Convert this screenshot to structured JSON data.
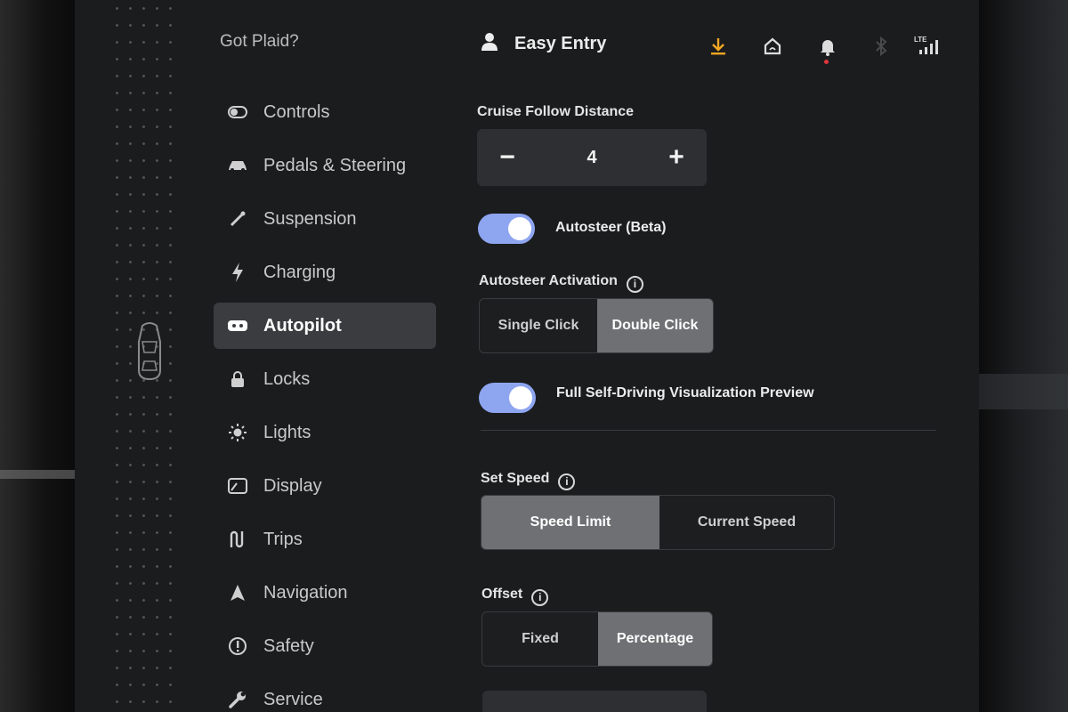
{
  "sidebar": {
    "profile_name": "Got Plaid?",
    "items": [
      {
        "label": "Controls"
      },
      {
        "label": "Pedals & Steering"
      },
      {
        "label": "Suspension"
      },
      {
        "label": "Charging"
      },
      {
        "label": "Autopilot",
        "active": true
      },
      {
        "label": "Locks"
      },
      {
        "label": "Lights"
      },
      {
        "label": "Display"
      },
      {
        "label": "Trips"
      },
      {
        "label": "Navigation"
      },
      {
        "label": "Safety"
      },
      {
        "label": "Service"
      }
    ]
  },
  "topbar": {
    "user_label": "Easy Entry",
    "network_label": "LTE",
    "accent_color": "#f5a623"
  },
  "autopilot": {
    "cruise_follow_label": "Cruise Follow Distance",
    "cruise_follow_value": "4",
    "autosteer_label": "Autosteer (Beta)",
    "autosteer_on": true,
    "activation_label": "Autosteer Activation",
    "activation_options": [
      "Single Click",
      "Double Click"
    ],
    "activation_selected": "Double Click",
    "fsd_preview_label": "Full Self-Driving Visualization Preview",
    "fsd_preview_on": true,
    "set_speed_label": "Set Speed",
    "set_speed_options": [
      "Speed Limit",
      "Current Speed"
    ],
    "set_speed_selected": "Speed Limit",
    "offset_label": "Offset",
    "offset_options": [
      "Fixed",
      "Percentage"
    ],
    "offset_selected": "Percentage",
    "toggle_color": "#8ea5f0"
  }
}
